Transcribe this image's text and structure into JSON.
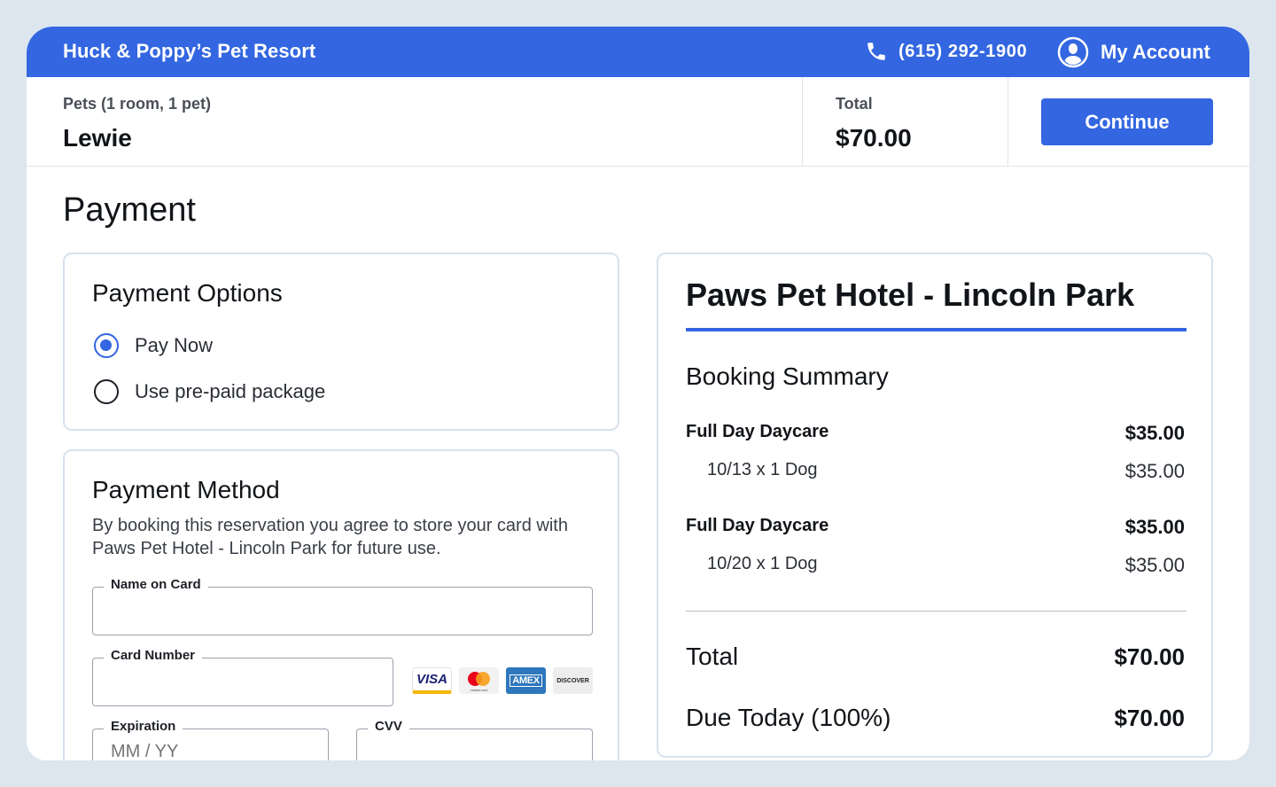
{
  "header": {
    "brand": "Huck & Poppy’s Pet Resort",
    "phone": "(615) 292-1900",
    "account_label": "My Account",
    "accent_color": "#3366e0"
  },
  "strip": {
    "pets_label": "Pets (1 room, 1 pet)",
    "pet_name": "Lewie",
    "total_label": "Total",
    "total_value": "$70.00",
    "continue_label": "Continue"
  },
  "page_title": "Payment",
  "payment_options": {
    "title": "Payment Options",
    "options": [
      {
        "label": "Pay Now",
        "selected": true
      },
      {
        "label": "Use pre-paid package",
        "selected": false
      }
    ]
  },
  "payment_method": {
    "title": "Payment Method",
    "description": "By booking this reservation you agree to store your card with Paws Pet Hotel - Lincoln Park for future use.",
    "fields": {
      "name_label": "Name on Card",
      "name_value": "",
      "card_label": "Card Number",
      "card_value": "",
      "exp_label": "Expiration",
      "exp_placeholder": "MM / YY",
      "cvv_label": "CVV",
      "cvv_value": ""
    },
    "card_brands": [
      {
        "icon": "visa-icon",
        "text": "VISA"
      },
      {
        "icon": "mastercard-icon",
        "text": "mastercard"
      },
      {
        "icon": "amex-icon",
        "text": "AMEX"
      },
      {
        "icon": "discover-icon",
        "text": "DISCOVER"
      }
    ]
  },
  "summary": {
    "hotel_name": "Paws Pet Hotel - Lincoln Park",
    "booking_title": "Booking Summary",
    "items": [
      {
        "name": "Full Day Daycare",
        "amount": "$35.00",
        "detail": "10/13 x 1 Dog",
        "detail_amount": "$35.00"
      },
      {
        "name": "Full Day Daycare",
        "amount": "$35.00",
        "detail": "10/20 x 1 Dog",
        "detail_amount": "$35.00"
      }
    ],
    "total_label": "Total",
    "total_amount": "$70.00",
    "due_label": "Due Today (100%)",
    "due_amount": "$70.00"
  }
}
